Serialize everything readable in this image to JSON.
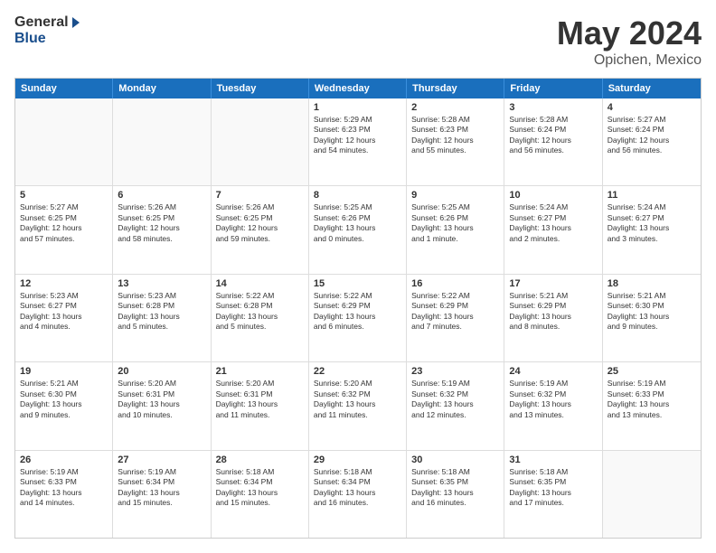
{
  "header": {
    "logo_general": "General",
    "logo_blue": "Blue",
    "month": "May 2024",
    "location": "Opichen, Mexico"
  },
  "weekdays": [
    "Sunday",
    "Monday",
    "Tuesday",
    "Wednesday",
    "Thursday",
    "Friday",
    "Saturday"
  ],
  "rows": [
    [
      {
        "day": "",
        "text": "",
        "empty": true
      },
      {
        "day": "",
        "text": "",
        "empty": true
      },
      {
        "day": "",
        "text": "",
        "empty": true
      },
      {
        "day": "1",
        "text": "Sunrise: 5:29 AM\nSunset: 6:23 PM\nDaylight: 12 hours\nand 54 minutes.",
        "empty": false
      },
      {
        "day": "2",
        "text": "Sunrise: 5:28 AM\nSunset: 6:23 PM\nDaylight: 12 hours\nand 55 minutes.",
        "empty": false
      },
      {
        "day": "3",
        "text": "Sunrise: 5:28 AM\nSunset: 6:24 PM\nDaylight: 12 hours\nand 56 minutes.",
        "empty": false
      },
      {
        "day": "4",
        "text": "Sunrise: 5:27 AM\nSunset: 6:24 PM\nDaylight: 12 hours\nand 56 minutes.",
        "empty": false
      }
    ],
    [
      {
        "day": "5",
        "text": "Sunrise: 5:27 AM\nSunset: 6:25 PM\nDaylight: 12 hours\nand 57 minutes.",
        "empty": false
      },
      {
        "day": "6",
        "text": "Sunrise: 5:26 AM\nSunset: 6:25 PM\nDaylight: 12 hours\nand 58 minutes.",
        "empty": false
      },
      {
        "day": "7",
        "text": "Sunrise: 5:26 AM\nSunset: 6:25 PM\nDaylight: 12 hours\nand 59 minutes.",
        "empty": false
      },
      {
        "day": "8",
        "text": "Sunrise: 5:25 AM\nSunset: 6:26 PM\nDaylight: 13 hours\nand 0 minutes.",
        "empty": false
      },
      {
        "day": "9",
        "text": "Sunrise: 5:25 AM\nSunset: 6:26 PM\nDaylight: 13 hours\nand 1 minute.",
        "empty": false
      },
      {
        "day": "10",
        "text": "Sunrise: 5:24 AM\nSunset: 6:27 PM\nDaylight: 13 hours\nand 2 minutes.",
        "empty": false
      },
      {
        "day": "11",
        "text": "Sunrise: 5:24 AM\nSunset: 6:27 PM\nDaylight: 13 hours\nand 3 minutes.",
        "empty": false
      }
    ],
    [
      {
        "day": "12",
        "text": "Sunrise: 5:23 AM\nSunset: 6:27 PM\nDaylight: 13 hours\nand 4 minutes.",
        "empty": false
      },
      {
        "day": "13",
        "text": "Sunrise: 5:23 AM\nSunset: 6:28 PM\nDaylight: 13 hours\nand 5 minutes.",
        "empty": false
      },
      {
        "day": "14",
        "text": "Sunrise: 5:22 AM\nSunset: 6:28 PM\nDaylight: 13 hours\nand 5 minutes.",
        "empty": false
      },
      {
        "day": "15",
        "text": "Sunrise: 5:22 AM\nSunset: 6:29 PM\nDaylight: 13 hours\nand 6 minutes.",
        "empty": false
      },
      {
        "day": "16",
        "text": "Sunrise: 5:22 AM\nSunset: 6:29 PM\nDaylight: 13 hours\nand 7 minutes.",
        "empty": false
      },
      {
        "day": "17",
        "text": "Sunrise: 5:21 AM\nSunset: 6:29 PM\nDaylight: 13 hours\nand 8 minutes.",
        "empty": false
      },
      {
        "day": "18",
        "text": "Sunrise: 5:21 AM\nSunset: 6:30 PM\nDaylight: 13 hours\nand 9 minutes.",
        "empty": false
      }
    ],
    [
      {
        "day": "19",
        "text": "Sunrise: 5:21 AM\nSunset: 6:30 PM\nDaylight: 13 hours\nand 9 minutes.",
        "empty": false
      },
      {
        "day": "20",
        "text": "Sunrise: 5:20 AM\nSunset: 6:31 PM\nDaylight: 13 hours\nand 10 minutes.",
        "empty": false
      },
      {
        "day": "21",
        "text": "Sunrise: 5:20 AM\nSunset: 6:31 PM\nDaylight: 13 hours\nand 11 minutes.",
        "empty": false
      },
      {
        "day": "22",
        "text": "Sunrise: 5:20 AM\nSunset: 6:32 PM\nDaylight: 13 hours\nand 11 minutes.",
        "empty": false
      },
      {
        "day": "23",
        "text": "Sunrise: 5:19 AM\nSunset: 6:32 PM\nDaylight: 13 hours\nand 12 minutes.",
        "empty": false
      },
      {
        "day": "24",
        "text": "Sunrise: 5:19 AM\nSunset: 6:32 PM\nDaylight: 13 hours\nand 13 minutes.",
        "empty": false
      },
      {
        "day": "25",
        "text": "Sunrise: 5:19 AM\nSunset: 6:33 PM\nDaylight: 13 hours\nand 13 minutes.",
        "empty": false
      }
    ],
    [
      {
        "day": "26",
        "text": "Sunrise: 5:19 AM\nSunset: 6:33 PM\nDaylight: 13 hours\nand 14 minutes.",
        "empty": false
      },
      {
        "day": "27",
        "text": "Sunrise: 5:19 AM\nSunset: 6:34 PM\nDaylight: 13 hours\nand 15 minutes.",
        "empty": false
      },
      {
        "day": "28",
        "text": "Sunrise: 5:18 AM\nSunset: 6:34 PM\nDaylight: 13 hours\nand 15 minutes.",
        "empty": false
      },
      {
        "day": "29",
        "text": "Sunrise: 5:18 AM\nSunset: 6:34 PM\nDaylight: 13 hours\nand 16 minutes.",
        "empty": false
      },
      {
        "day": "30",
        "text": "Sunrise: 5:18 AM\nSunset: 6:35 PM\nDaylight: 13 hours\nand 16 minutes.",
        "empty": false
      },
      {
        "day": "31",
        "text": "Sunrise: 5:18 AM\nSunset: 6:35 PM\nDaylight: 13 hours\nand 17 minutes.",
        "empty": false
      },
      {
        "day": "",
        "text": "",
        "empty": true
      }
    ]
  ]
}
